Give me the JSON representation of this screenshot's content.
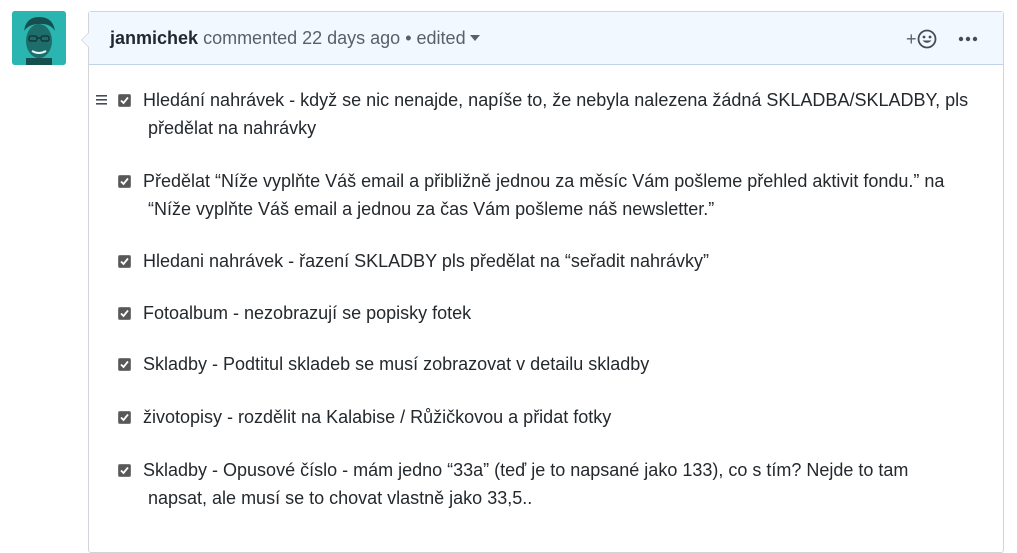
{
  "comment": {
    "author": "janmichek",
    "action": "commented 22 days ago",
    "separator": "•",
    "edited": "edited",
    "reaction_plus": "+"
  },
  "tasks": [
    {
      "checked": true,
      "line1": "Hledání nahrávek - když se nic nenajde, napíše to, že nebyla nalezena žádná SKLADBA/SKLADBY, pls",
      "line2": "předělat na nahrávky"
    },
    {
      "checked": true,
      "line1": "Předělat “Níže vyplňte Váš email a přibližně jednou za měsíc Vám pošleme přehled aktivit fondu.” na",
      "line2": "“Níže vyplňte Váš email a jednou za čas Vám pošleme náš newsletter.”"
    },
    {
      "checked": true,
      "line1": "Hledani nahrávek - řazení SKLADBY pls předělat na “seřadit nahrávky”"
    },
    {
      "checked": true,
      "line1": "Fotoalbum - nezobrazují se popisky fotek"
    },
    {
      "checked": true,
      "line1": "Skladby - Podtitul skladeb se musí zobrazovat v detailu skladby"
    },
    {
      "checked": true,
      "line1": "životopisy - rozdělit na Kalabise / Růžičkovou a přidat fotky"
    },
    {
      "checked": true,
      "line1": "Skladby - Opusové číslo - mám jedno “33a” (teď je to napsané jako 133), co s tím? Nejde to tam",
      "line2": "napsat, ale musí se to chovat vlastně jako 33,5.."
    }
  ],
  "icons": {
    "avatar": "avatar",
    "smiley": "smiley-icon",
    "kebab": "kebab-horizontal-icon",
    "drag": "grabber-icon",
    "check": "check-icon",
    "caret": "triangle-down-icon"
  },
  "colors": {
    "header_bg": "#f1f8ff",
    "border": "#c0d3eb",
    "checkbox": "#585858",
    "avatar_bg": "#2bb5b0"
  }
}
